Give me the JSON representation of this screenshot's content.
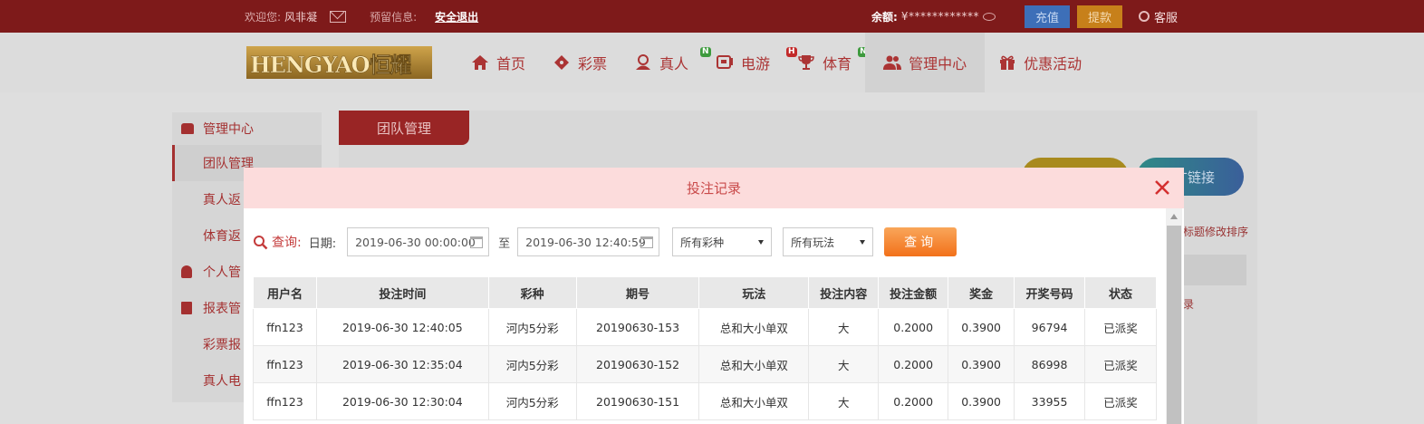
{
  "topbar": {
    "welcome_label": "欢迎您:",
    "username": "风非凝",
    "reserve_label": "预留信息:",
    "logout_label": "安全退出",
    "balance_label": "余额:",
    "balance_value": "¥************",
    "deposit_label": "充值",
    "withdraw_label": "提款",
    "service_label": "客服"
  },
  "logo": {
    "text": "HENGYAO恒耀"
  },
  "nav": {
    "items": [
      {
        "label": "首页",
        "icon": "home-icon",
        "badge": ""
      },
      {
        "label": "彩票",
        "icon": "ticket-icon",
        "badge": ""
      },
      {
        "label": "真人",
        "icon": "dealer-icon",
        "badge": "N"
      },
      {
        "label": "电游",
        "icon": "slot-icon",
        "badge": "H"
      },
      {
        "label": "体育",
        "icon": "trophy-icon",
        "badge": "N"
      },
      {
        "label": "管理中心",
        "icon": "users-icon",
        "badge": ""
      },
      {
        "label": "优惠活动",
        "icon": "gift-icon",
        "badge": ""
      }
    ]
  },
  "sidebar": {
    "section1": "管理中心",
    "items1": [
      "团队管理",
      "真人返",
      "体育返"
    ],
    "section2": "个人管",
    "section3": "报表管",
    "items3": [
      "彩票报",
      "真人电"
    ]
  },
  "content": {
    "tab_label": "团队管理",
    "link_button_label": "广链接",
    "note_text": "标题修改排序",
    "side_text": "录"
  },
  "modal": {
    "title": "投注记录",
    "query_label": "查询:",
    "date_label": "日期:",
    "date_from": "2019-06-30 00:00:00",
    "to_label": "至",
    "date_to": "2019-06-30 12:40:59",
    "lottery_select": "所有彩种",
    "play_select": "所有玩法",
    "query_button": "查询"
  },
  "table": {
    "headers": [
      "用户名",
      "投注时间",
      "彩种",
      "期号",
      "玩法",
      "投注内容",
      "投注金额",
      "奖金",
      "开奖号码",
      "状态"
    ],
    "rows": [
      [
        "ffn123",
        "2019-06-30 12:40:05",
        "河内5分彩",
        "20190630-153",
        "总和大小单双",
        "大",
        "0.2000",
        "0.3900",
        "96794",
        "已派奖"
      ],
      [
        "ffn123",
        "2019-06-30 12:35:04",
        "河内5分彩",
        "20190630-152",
        "总和大小单双",
        "大",
        "0.2000",
        "0.3900",
        "86998",
        "已派奖"
      ],
      [
        "ffn123",
        "2019-06-30 12:30:04",
        "河内5分彩",
        "20190630-151",
        "总和大小单双",
        "大",
        "0.2000",
        "0.3900",
        "33955",
        "已派奖"
      ]
    ]
  }
}
